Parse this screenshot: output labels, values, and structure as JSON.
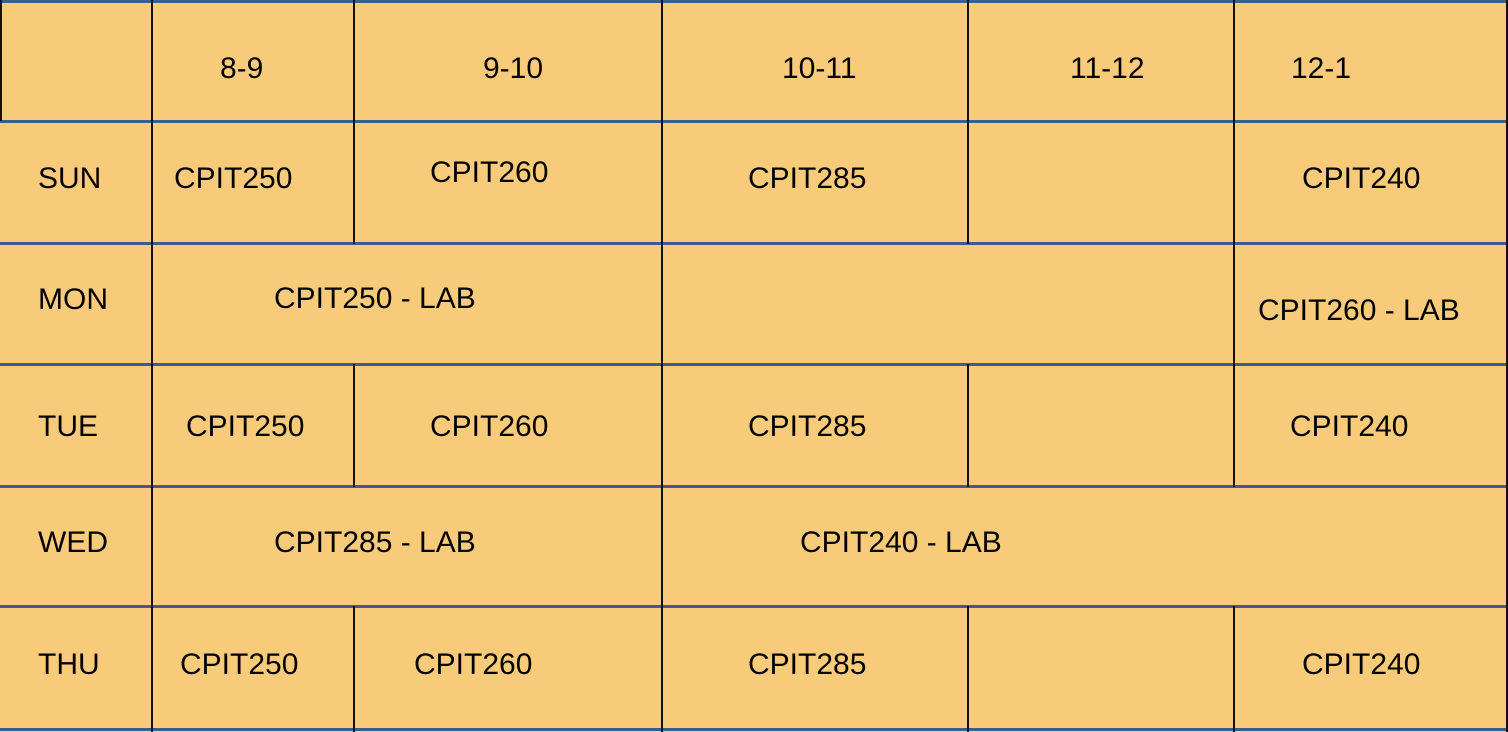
{
  "timetable": {
    "time_slots": [
      "8-9",
      "9-10",
      "10-11",
      "11-12",
      "12-1"
    ],
    "rows": [
      {
        "day": "SUN",
        "slots": [
          {
            "span": "8-9",
            "course": "CPIT250"
          },
          {
            "span": "9-10",
            "course": "CPIT260"
          },
          {
            "span": "10-11",
            "course": "CPIT285"
          },
          {
            "span": "11-12",
            "course": ""
          },
          {
            "span": "12-1",
            "course": "CPIT240"
          }
        ]
      },
      {
        "day": "MON",
        "slots": [
          {
            "span": "8-10",
            "course": "CPIT250 - LAB"
          },
          {
            "span": "10-12",
            "course": ""
          },
          {
            "span": "12-1",
            "course": "CPIT260 - LAB"
          }
        ]
      },
      {
        "day": "TUE",
        "slots": [
          {
            "span": "8-9",
            "course": "CPIT250"
          },
          {
            "span": "9-10",
            "course": "CPIT260"
          },
          {
            "span": "10-11",
            "course": "CPIT285"
          },
          {
            "span": "11-12",
            "course": ""
          },
          {
            "span": "12-1",
            "course": "CPIT240"
          }
        ]
      },
      {
        "day": "WED",
        "slots": [
          {
            "span": "8-10",
            "course": "CPIT285 - LAB"
          },
          {
            "span": "10-12",
            "course": "CPIT240 - LAB"
          },
          {
            "span": "12-1",
            "course": ""
          }
        ]
      },
      {
        "day": "THU",
        "slots": [
          {
            "span": "8-9",
            "course": "CPIT250"
          },
          {
            "span": "9-10",
            "course": "CPIT260"
          },
          {
            "span": "10-11",
            "course": "CPIT285"
          },
          {
            "span": "11-12",
            "course": ""
          },
          {
            "span": "12-1",
            "course": "CPIT240"
          }
        ]
      }
    ]
  },
  "colors": {
    "cell_fill": "#F8CB7A",
    "row_border": "#3E5C93",
    "column_border": "#111111"
  }
}
